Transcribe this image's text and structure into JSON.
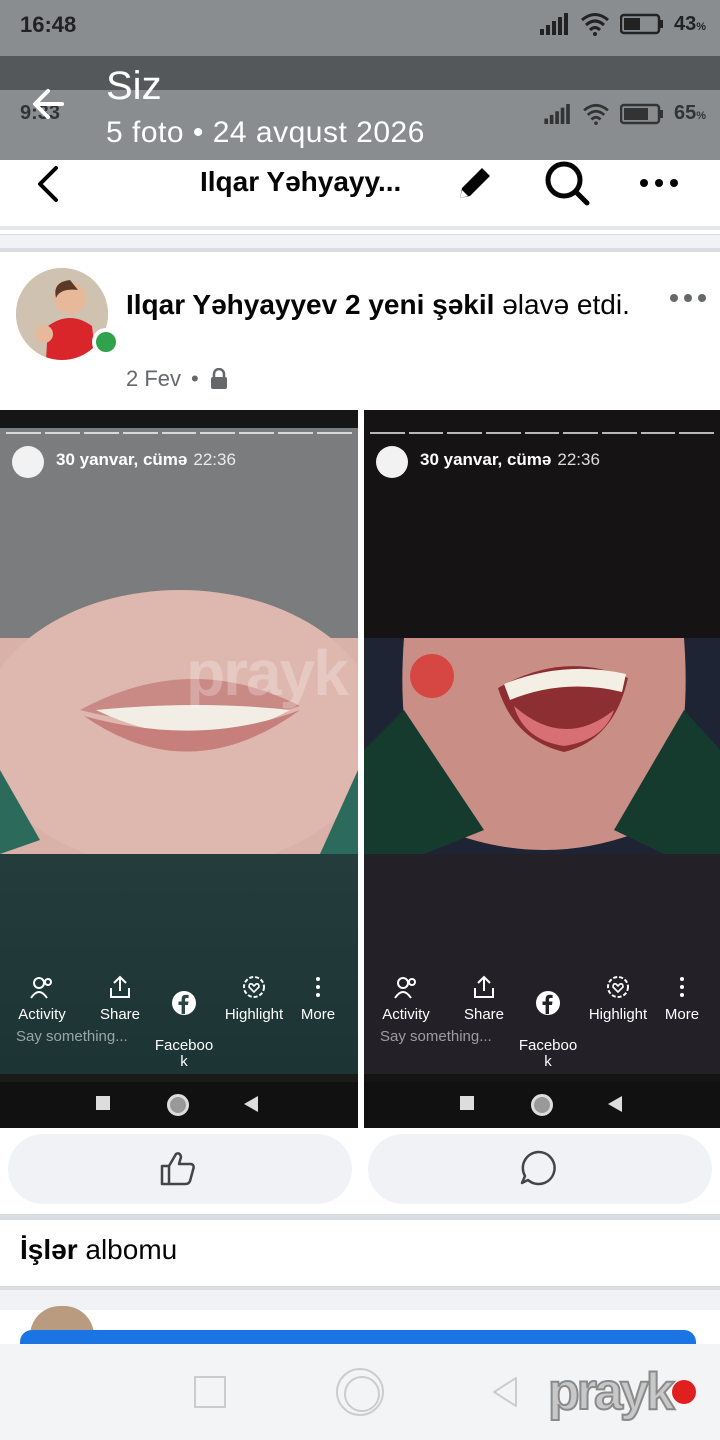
{
  "outer_status": {
    "time": "16:48",
    "battery": "43",
    "battery_unit": "%"
  },
  "gallery": {
    "title": "Siz",
    "subtitle": "5 foto  •  24 avqust 2026"
  },
  "inner_status": {
    "time": "9:33",
    "battery": "65",
    "battery_unit": "%"
  },
  "appbar": {
    "title": "Ilqar Yəhyayy..."
  },
  "post": {
    "author": "Ilqar Yəhyayyev",
    "highlight": "2 yeni şəkil",
    "action": "əlavə etdi.",
    "date": "2 Fev",
    "privacy_icon": "lock-icon"
  },
  "photos": [
    {
      "date": "30 yanvar, cümə",
      "time": "22:36",
      "actions": [
        "Activity",
        "Share",
        "Faceboo\nk",
        "Highlight",
        "More"
      ],
      "say": "Say something..."
    },
    {
      "date": "30 yanvar, cümə",
      "time": "22:36",
      "actions": [
        "Activity",
        "Share",
        "Faceboo\nk",
        "Highlight",
        "More"
      ],
      "say": "Say something..."
    }
  ],
  "watermark": "prayk",
  "album": {
    "bold": "İşlər",
    "rest": " albomu"
  },
  "logo": "prayk",
  "colors": {
    "accent": "#1b74e4",
    "online": "#31a24c",
    "brand_dot": "#e02020"
  }
}
